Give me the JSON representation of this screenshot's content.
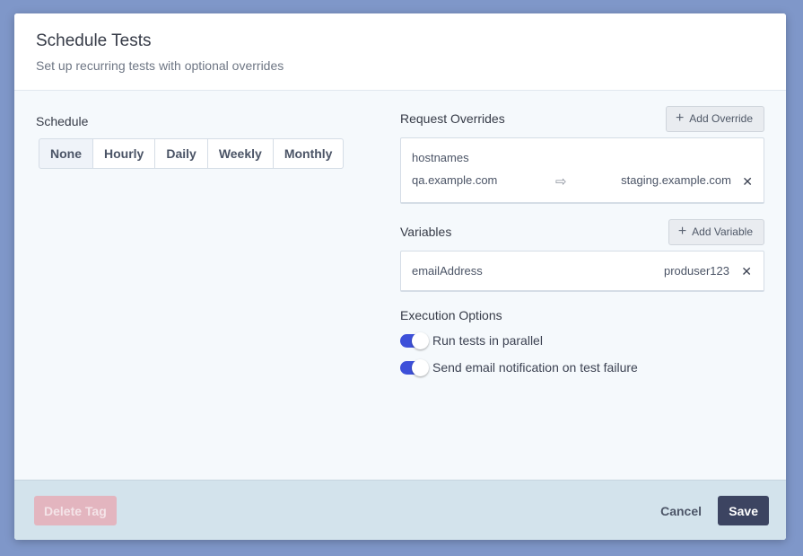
{
  "modal": {
    "title": "Schedule Tests",
    "subtitle": "Set up recurring tests with optional overrides"
  },
  "schedule": {
    "label": "Schedule",
    "options": [
      "None",
      "Hourly",
      "Daily",
      "Weekly",
      "Monthly"
    ],
    "selected": "None"
  },
  "overrides": {
    "label": "Request Overrides",
    "add_label": "Add Override",
    "items": [
      {
        "key": "hostnames",
        "from": "qa.example.com",
        "to": "staging.example.com"
      }
    ]
  },
  "variables": {
    "label": "Variables",
    "add_label": "Add Variable",
    "items": [
      {
        "name": "emailAddress",
        "value": "produser123"
      }
    ]
  },
  "execution": {
    "label": "Execution Options",
    "options": [
      {
        "label": "Run tests in parallel",
        "enabled": true
      },
      {
        "label": "Send email notification on test failure",
        "enabled": true
      }
    ]
  },
  "footer": {
    "delete_label": "Delete Tag",
    "cancel_label": "Cancel",
    "save_label": "Save"
  },
  "icons": {
    "add": "plus-icon",
    "arrow": "arrow-right-icon",
    "remove": "close-icon"
  },
  "colors": {
    "accent": "#3d50d9",
    "primary_button": "#3c4461",
    "danger_disabled": "#e3b5bf",
    "backdrop": "#7f97c9"
  }
}
